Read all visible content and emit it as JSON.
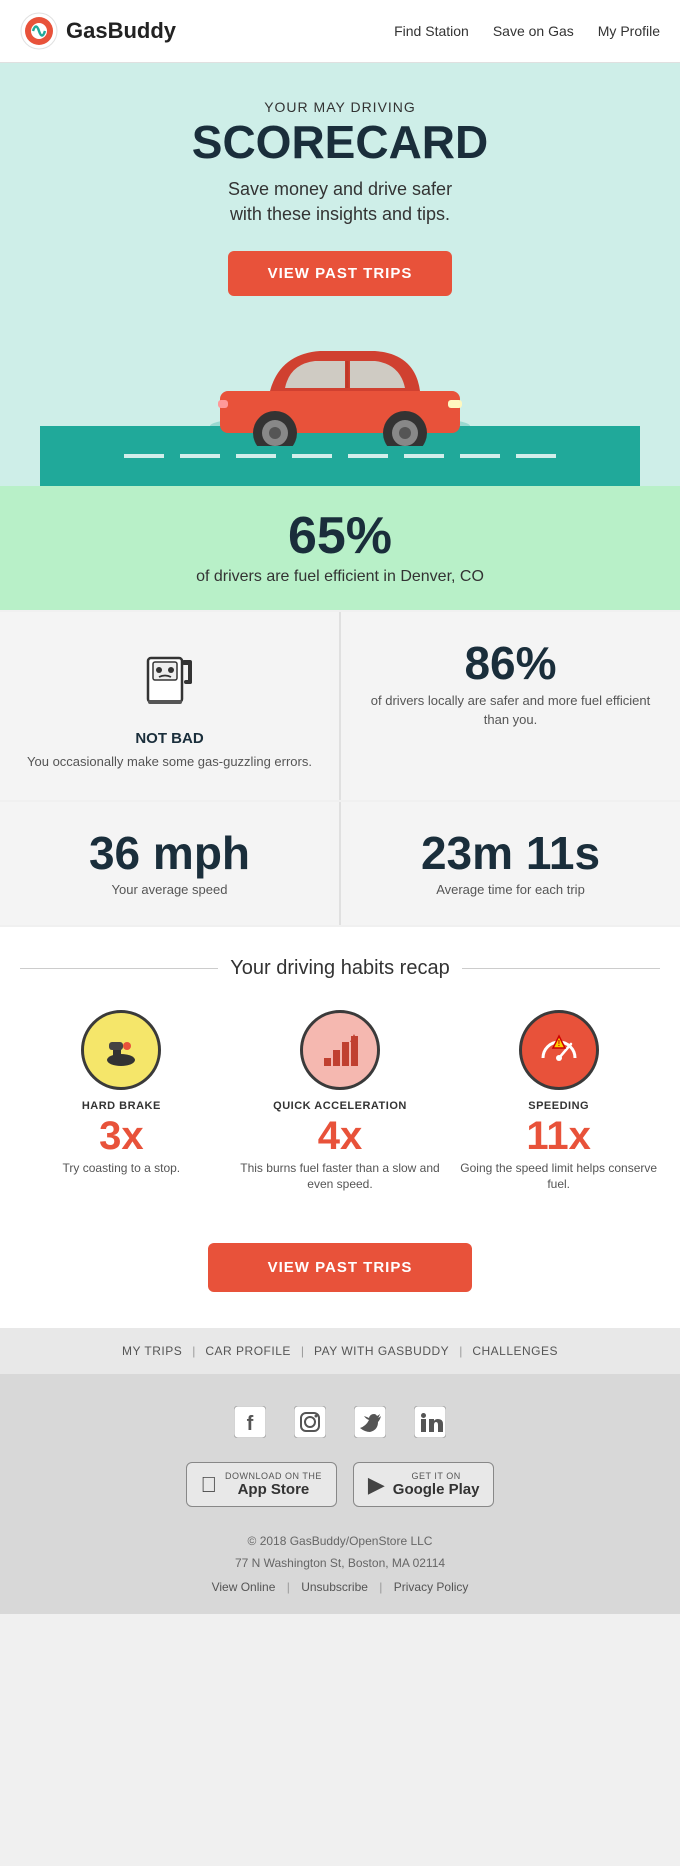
{
  "header": {
    "logo_text": "GasBuddy",
    "nav": {
      "find_station": "Find Station",
      "save_on_gas": "Save on Gas",
      "my_profile": "My Profile"
    }
  },
  "hero": {
    "month_label": "YOUR MAY DRIVING",
    "title": "SCORECARD",
    "description": "Save money and drive safer\nwith these insights and tips.",
    "cta_button": "VIEW PAST TRIPS"
  },
  "efficiency_banner": {
    "percentage": "65%",
    "description": "of drivers are fuel efficient in Denver, CO"
  },
  "stats": {
    "gas_label": "NOT BAD",
    "gas_desc": "You occasionally make some gas-guzzling errors.",
    "driver_pct": "86%",
    "driver_desc": "of drivers locally are safer and more fuel efficient than you.",
    "avg_speed": "36 mph",
    "avg_speed_desc": "Your average speed",
    "avg_time": "23m 11s",
    "avg_time_desc": "Average time for each trip"
  },
  "habits": {
    "section_title": "Your driving habits recap",
    "items": [
      {
        "label": "HARD BRAKE",
        "count": "3x",
        "desc": "Try coasting to a stop.",
        "icon": "🦵"
      },
      {
        "label": "QUICK ACCELERATION",
        "count": "4x",
        "desc": "This burns fuel faster than a slow and even speed.",
        "icon": "📈"
      },
      {
        "label": "SPEEDING",
        "count": "11x",
        "desc": "Going the speed limit helps conserve fuel.",
        "icon": "⏱"
      }
    ]
  },
  "cta2": {
    "button": "VIEW PAST TRIPS"
  },
  "footer_nav": {
    "items": [
      "MY TRIPS",
      "CAR PROFILE",
      "PAY WITH GASBUDDY",
      "CHALLENGES"
    ]
  },
  "footer": {
    "social_icons": [
      "facebook",
      "instagram",
      "twitter",
      "linkedin"
    ],
    "app_store": "App Store",
    "google_play": "Google Play",
    "copyright": "© 2018 GasBuddy/OpenStore LLC",
    "address": "77 N Washington St, Boston, MA 02114",
    "links": [
      "View Online",
      "Unsubscribe",
      "Privacy Policy"
    ]
  }
}
